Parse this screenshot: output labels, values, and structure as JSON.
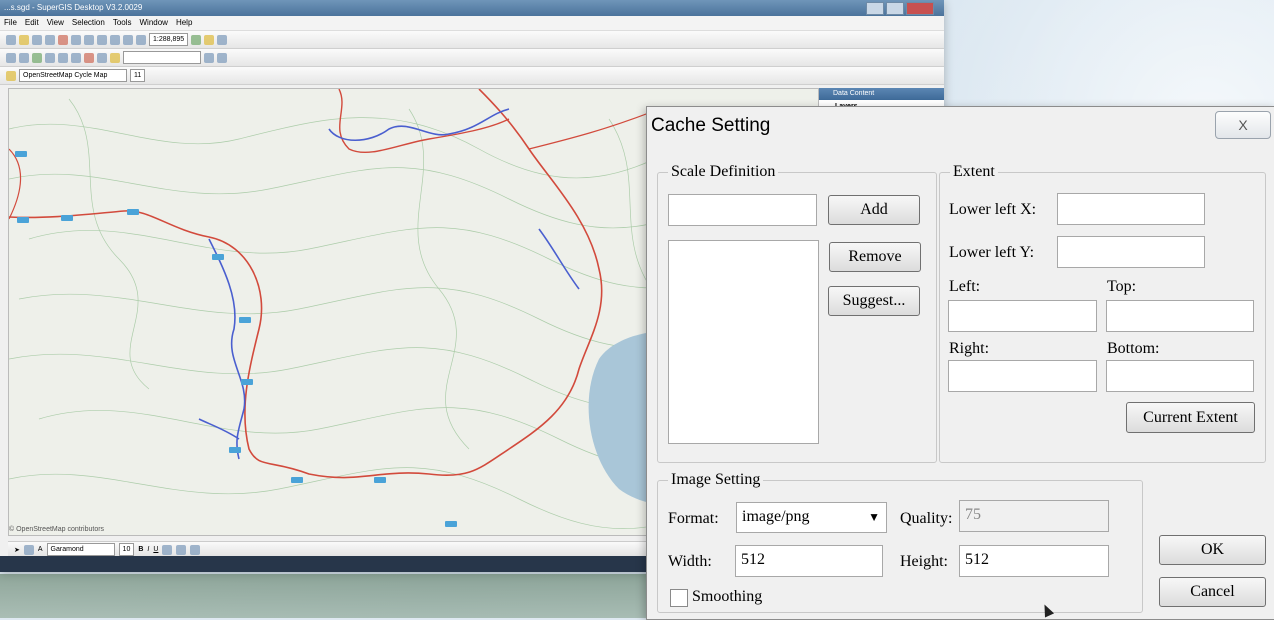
{
  "app": {
    "title": "...s.sgd - SuperGIS Desktop V3.2.0029",
    "menu": [
      "File",
      "Edit",
      "View",
      "Selection",
      "Tools",
      "Window",
      "Help"
    ],
    "scale_combo": "1:288,895",
    "basemap_combo": "OpenStreetMap Cycle Map",
    "zoom_combo": "11",
    "attribution": "© OpenStreetMap contributors",
    "side_panel_title": "Data Content",
    "side_panel_item": "Layers",
    "font_combo": "Garamond",
    "font_size_combo": "10",
    "format_buttons": [
      "B",
      "I",
      "U"
    ]
  },
  "dialog": {
    "title": "Cache Setting",
    "close_label": "X",
    "scale_definition": {
      "legend": "Scale Definition",
      "input_value": "",
      "add_label": "Add",
      "remove_label": "Remove",
      "suggest_label": "Suggest..."
    },
    "extent": {
      "legend": "Extent",
      "lower_left_x_label": "Lower left X:",
      "lower_left_y_label": "Lower left Y:",
      "left_label": "Left:",
      "top_label": "Top:",
      "right_label": "Right:",
      "bottom_label": "Bottom:",
      "current_extent_label": "Current Extent"
    },
    "image_setting": {
      "legend": "Image Setting",
      "format_label": "Format:",
      "format_value": "image/png",
      "quality_label": "Quality:",
      "quality_value": "75",
      "width_label": "Width:",
      "width_value": "512",
      "height_label": "Height:",
      "height_value": "512",
      "smoothing_label": "Smoothing"
    },
    "ok_label": "OK",
    "cancel_label": "Cancel"
  },
  "colors": {
    "route_red": "#d24a3c",
    "route_blue": "#4a5fcf",
    "map_bg": "#eef0ea",
    "water": "#a9c6d8",
    "contour": "#9cc49a"
  }
}
